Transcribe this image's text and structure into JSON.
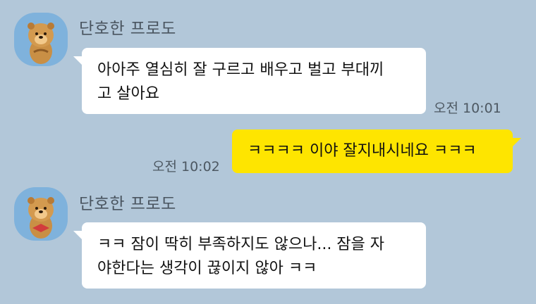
{
  "colors": {
    "background": "#b2c7d9",
    "incoming_bubble": "#ffffff",
    "outgoing_bubble": "#fee500",
    "avatar_bg": "#7fb2dc"
  },
  "messages": [
    {
      "direction": "incoming",
      "sender": "단호한 프로도",
      "avatar_icon": "frodo-character-icon",
      "lines": [
        "아아주 열심히 잘 구르고 배우고 벌고 부대끼",
        "고 살아요"
      ],
      "time": "오전 10:01"
    },
    {
      "direction": "outgoing",
      "lines": [
        "ㅋㅋㅋㅋ 이야 잘지내시네요 ㅋㅋㅋ"
      ],
      "time": "오전 10:02"
    },
    {
      "direction": "incoming",
      "sender": "단호한 프로도",
      "avatar_icon": "frodo-character-icon",
      "lines": [
        "ㅋㅋ 잠이 딱히 부족하지도 않으나... 잠을 자",
        "야한다는 생각이 끊이지 않아 ㅋㅋ"
      ],
      "time": ""
    }
  ]
}
